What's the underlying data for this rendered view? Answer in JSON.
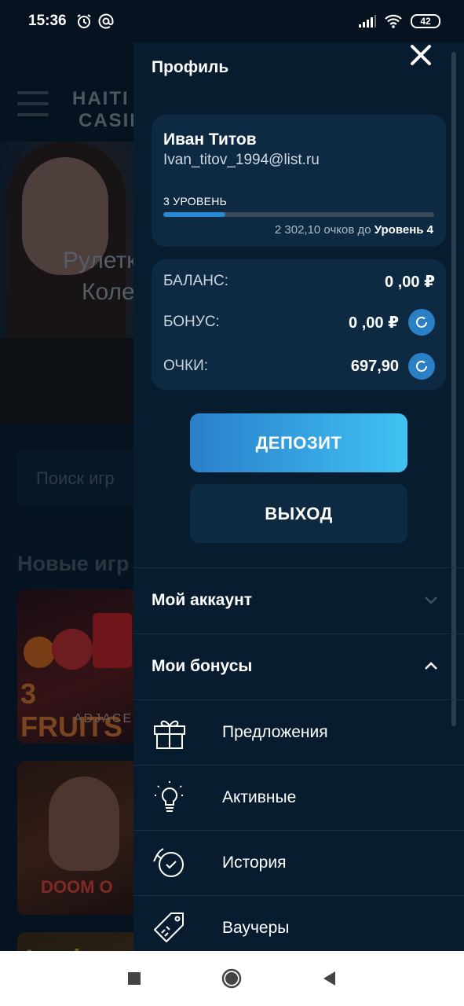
{
  "status_bar": {
    "time": "15:36",
    "battery": "42"
  },
  "background": {
    "logo_line1": "HAITI",
    "logo_line2": "CASIN",
    "banner_text_line1": "Рулетк",
    "banner_text_line2": "Коле",
    "search_placeholder": "Поиск игр",
    "new_games_heading": "Новые игр",
    "games": [
      {
        "title": "3 FRUITS",
        "subtitle": "ADJACE"
      },
      {
        "title": "DOOM O"
      },
      {
        "title": "Lucky"
      }
    ]
  },
  "drawer": {
    "title": "Профиль",
    "profile": {
      "name": "Иван Титов",
      "email": "Ivan_titov_1994@list.ru",
      "level_label": "3 УРОВЕНЬ",
      "level_progress": 0.23,
      "points_to_next": "2 302,10 очков до",
      "next_level": "Уровень 4"
    },
    "balance": {
      "balance_label": "БАЛАНС:",
      "balance_value": "0 ,00 ₽",
      "bonus_label": "БОНУС:",
      "bonus_value": "0 ,00 ₽",
      "points_label": "ОЧКИ:",
      "points_value": "697,90"
    },
    "deposit_label": "ДЕПОЗИТ",
    "logout_label": "ВЫХОД",
    "sections": {
      "my_account": "Мой аккаунт",
      "my_bonuses": "Мои бонусы"
    },
    "bonus_items": [
      {
        "label": "Предложения",
        "icon": "gift-icon"
      },
      {
        "label": "Активные",
        "icon": "lightbulb-icon"
      },
      {
        "label": "История",
        "icon": "history-clock-icon"
      },
      {
        "label": "Ваучеры",
        "icon": "voucher-tag-icon"
      }
    ]
  },
  "colors": {
    "accent": "#2a8ad4",
    "panel": "#0e2a42",
    "drawer_bg": "#081c30"
  }
}
